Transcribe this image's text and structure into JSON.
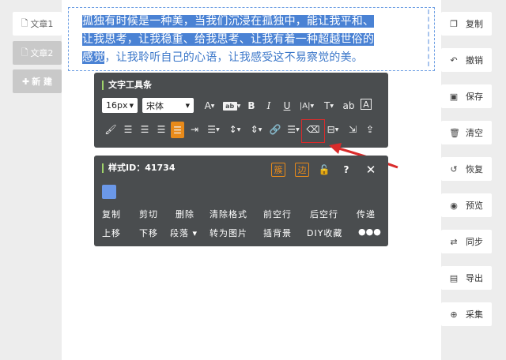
{
  "left": {
    "articles": [
      {
        "label": "文章1",
        "icon": "file-icon"
      },
      {
        "label": "文章2",
        "icon": "file-icon"
      }
    ],
    "new_label": "新 建"
  },
  "editor": {
    "text_highlighted_1": "孤独有时候是一种美，当我们沉浸在孤独中，能让我平和、",
    "text_highlighted_2": "让我思考，让我稳重、给我思考、让我有着一种超越世俗的",
    "text_highlighted_3": "感觉",
    "text_plain_3": "，让我聆听自己的心语，让我感受这不易察觉的美。"
  },
  "text_toolbar": {
    "title": "文字工具条",
    "font_size": "16px",
    "font_family": "宋体"
  },
  "style_panel": {
    "id_text": "样式ID：41734",
    "badge_1": "簇",
    "badge_2": "边",
    "swatch_color": "#6b98e8",
    "actions_row1": [
      "复制",
      "剪切",
      "删除",
      "清除格式",
      "前空行",
      "后空行",
      "传递"
    ],
    "actions_row2": [
      "上移",
      "下移",
      "段落 ▾",
      "转为图片",
      "插背景",
      "DIY收藏",
      "●●●"
    ]
  },
  "right": {
    "buttons": [
      {
        "label": "复制",
        "icon": "copy-icon"
      },
      {
        "label": "撤销",
        "icon": "undo-icon"
      },
      {
        "label": "保存",
        "icon": "save-icon"
      },
      {
        "label": "清空",
        "icon": "trash-icon"
      },
      {
        "label": "恢复",
        "icon": "restore-icon"
      },
      {
        "label": "预览",
        "icon": "eye-icon"
      },
      {
        "label": "同步",
        "icon": "sync-icon"
      },
      {
        "label": "导出",
        "icon": "image-export-icon"
      },
      {
        "label": "采集",
        "icon": "zoom-collect-icon"
      }
    ]
  },
  "colors": {
    "accent_orange": "#e88a1a",
    "highlight_blue": "#4a82d4",
    "panel_bg": "#4a4d4f",
    "annotation_red": "#d92b2b"
  }
}
